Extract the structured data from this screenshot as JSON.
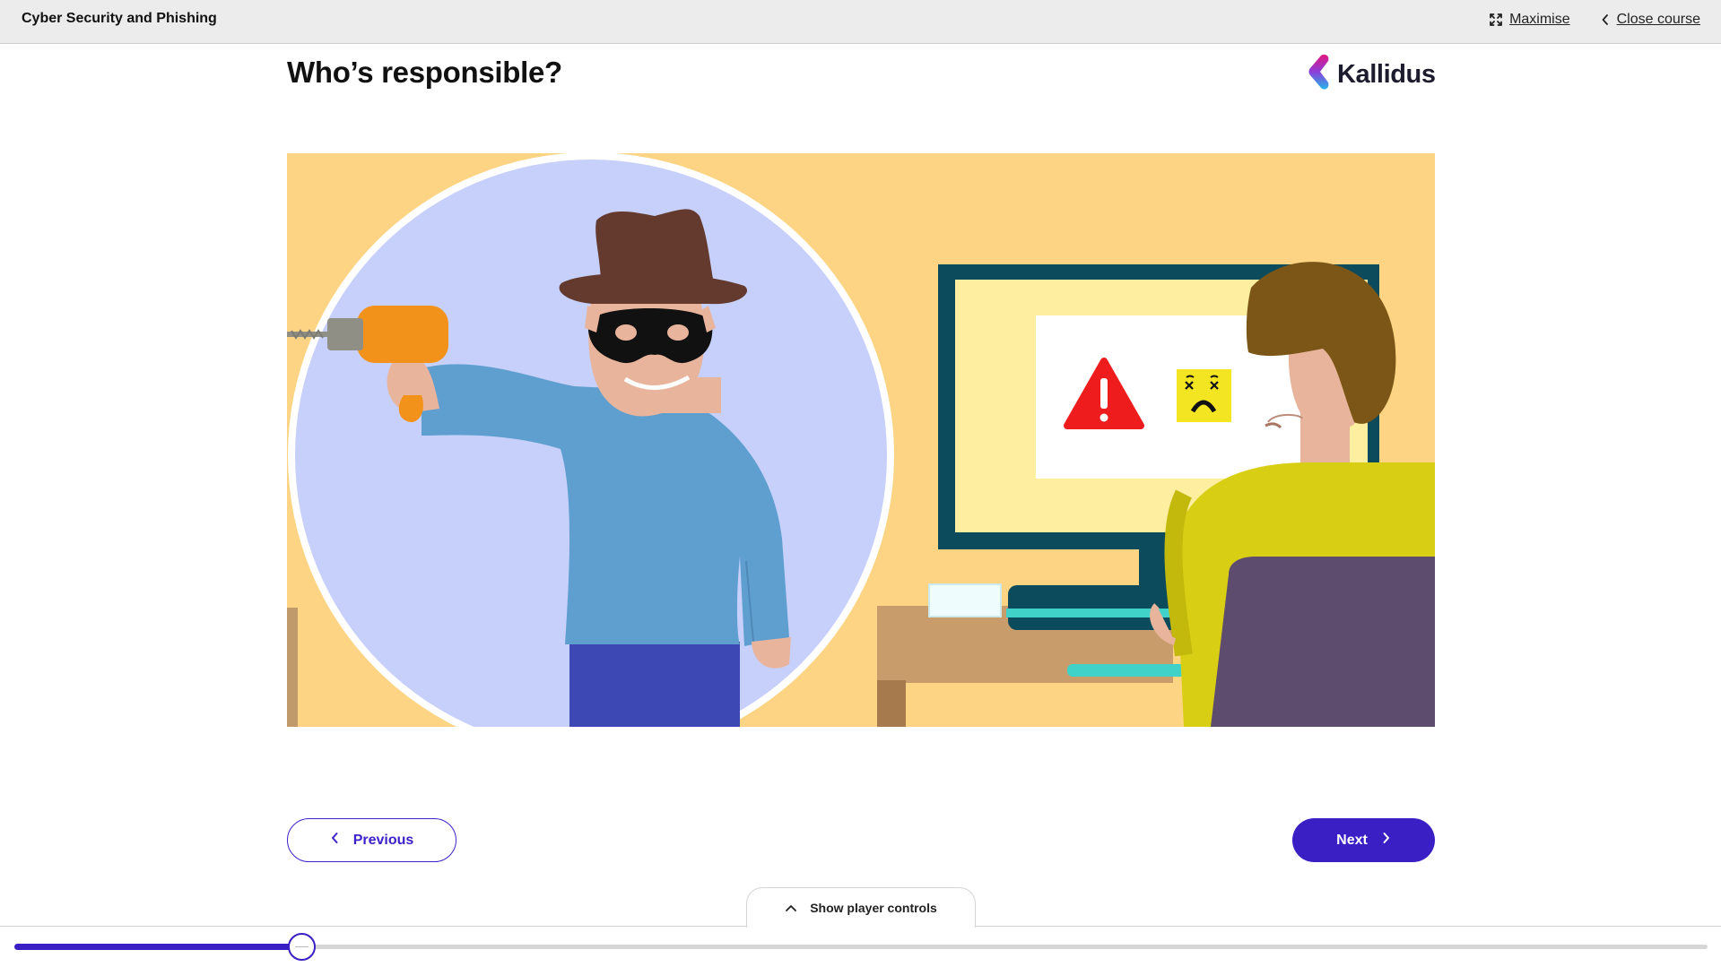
{
  "app": {
    "course_title": "Cyber Security and Phishing"
  },
  "header": {
    "maximise_label": "Maximise",
    "close_label": "Close course",
    "maximise_icon": "maximise-icon",
    "close_icon": "chevron-left-icon"
  },
  "slide": {
    "heading": "Who’s responsible?",
    "logo_text": "Kallidus",
    "illustration": "hacker-and-office-worker-illustration"
  },
  "navigation": {
    "previous_label": "Previous",
    "next_label": "Next"
  },
  "player": {
    "show_controls_label": "Show player controls",
    "progress_fraction": 0.17
  },
  "colors": {
    "accent": "#3a1fc4",
    "topbar": "#ececec",
    "illustration_background": "#fdd484",
    "circle": "#c7d0fb"
  }
}
